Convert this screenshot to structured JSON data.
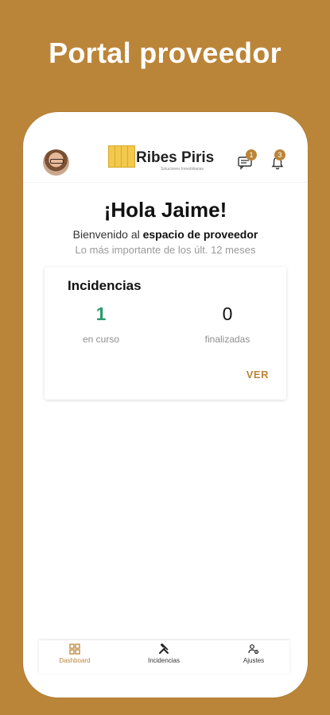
{
  "promo": {
    "title": "Portal proveedor"
  },
  "header": {
    "logo_name": "Ribes Piris",
    "logo_tagline": "Soluciones Inmobiliarias",
    "chat_badge": "1",
    "bell_badge": "3"
  },
  "main": {
    "greeting": "¡Hola Jaime!",
    "welcome_prefix": "Bienvenido al",
    "welcome_bold": "espacio de proveedor",
    "period": "Lo más importante de los últ. 12 meses"
  },
  "card": {
    "title": "Incidencias",
    "stats": [
      {
        "value": "1",
        "label": "en curso"
      },
      {
        "value": "0",
        "label": "finalizadas"
      }
    ],
    "action": "VER"
  },
  "nav": {
    "items": [
      {
        "label": "Dashboard",
        "icon": "dashboard-icon",
        "active": true
      },
      {
        "label": "Incidencias",
        "icon": "tools-icon",
        "active": false
      },
      {
        "label": "Ajustes",
        "icon": "settings-icon",
        "active": false
      }
    ]
  },
  "colors": {
    "background": "#BB8539",
    "accent": "#BB8539",
    "positive": "#2E9A6E"
  }
}
